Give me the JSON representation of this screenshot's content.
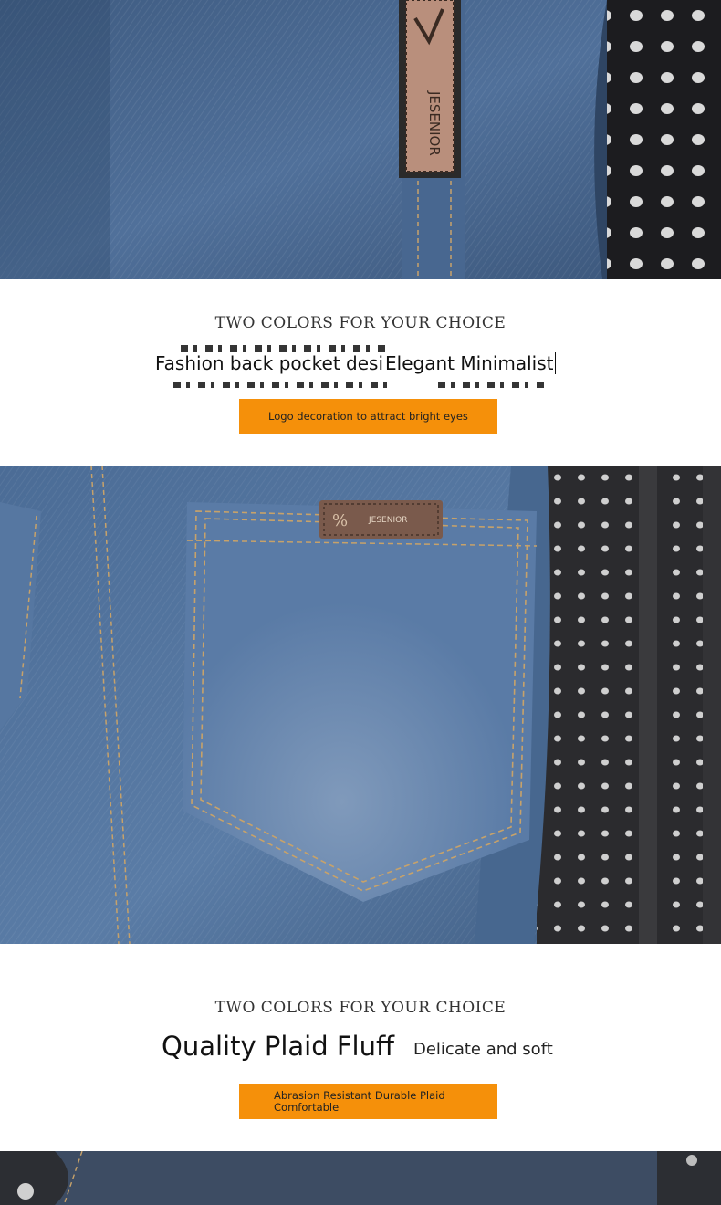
{
  "sections": [
    {
      "subtitle_en": "TWO COLORS FOR YOUR CHOICE",
      "headline_left": "Fashion back pocket desig",
      "headline_right": "Elegant Minimalist",
      "badge": "Logo decoration to attract bright eyes"
    },
    {
      "subtitle_en": "TWO COLORS FOR YOUR CHOICE",
      "headline_left": "Quality Plaid Fluff",
      "headline_right": "Delicate and soft",
      "badge": "Abrasion Resistant Durable Plaid Comfortable"
    }
  ],
  "photos": [
    {
      "subject": "denim-waistband-with-leather-label"
    },
    {
      "subject": "denim-back-pocket-with-leather-patch"
    },
    {
      "subject": "denim-detail-dark"
    }
  ],
  "colors": {
    "accent": "#f5900a",
    "denim": "#46658f"
  }
}
